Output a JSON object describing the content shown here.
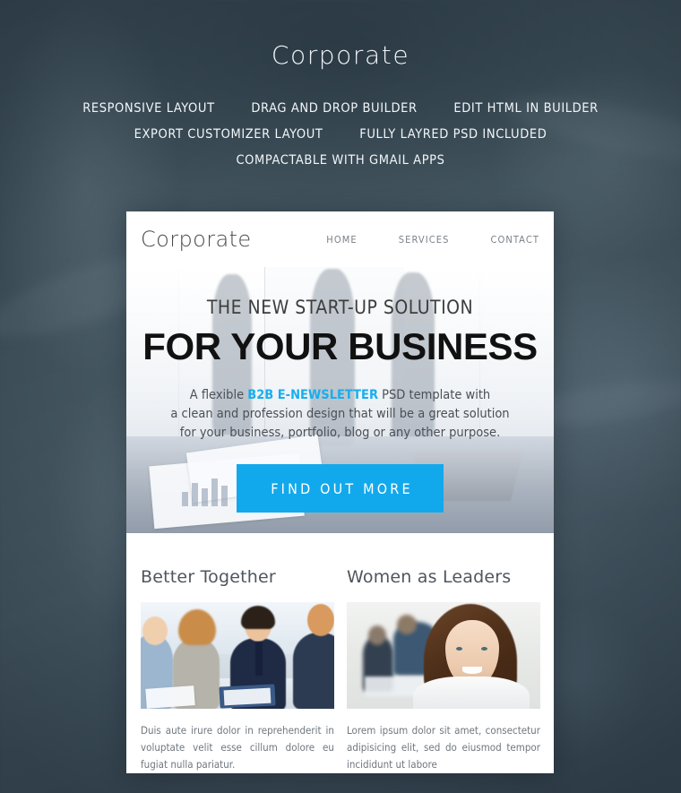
{
  "banner": {
    "title": "Corporate",
    "feature_rows": [
      [
        "RESPONSIVE LAYOUT",
        "DRAG AND DROP BUILDER",
        "EDIT HTML IN BUILDER"
      ],
      [
        "EXPORT CUSTOMIZER LAYOUT",
        "FULLY LAYRED PSD INCLUDED"
      ],
      [
        "COMPACTABLE WITH GMAIL APPS"
      ]
    ]
  },
  "template": {
    "nav": {
      "brand": "Corporate",
      "links": [
        "HOME",
        "SERVICES",
        "CONTACT"
      ]
    },
    "hero": {
      "kicker": "THE NEW START-UP SOLUTION",
      "title": "FOR YOUR BUSINESS",
      "para_part1": "A flexible ",
      "para_highlight": "B2B E-NEWSLETTER",
      "para_part2": " PSD template with",
      "para_line2": "a clean and profession design that will be a great solution",
      "para_line3": "for your business, portfolio, blog or any other purpose.",
      "cta_label": "FIND OUT MORE"
    },
    "columns": [
      {
        "title": "Better Together",
        "image_alt": "business-meeting-photo",
        "text": "Duis aute irure dolor in reprehenderit in voluptate velit esse cillum dolore eu fugiat nulla pariatur."
      },
      {
        "title": "Women as Leaders",
        "image_alt": "businesswoman-portrait-photo",
        "text": "Lorem ipsum dolor sit amet, consectetur adipisicing elit, sed do eiusmod tempor incididunt ut labore"
      }
    ]
  },
  "colors": {
    "accent": "#12a9ec",
    "highlight": "#17aeee",
    "backdrop": "#3f505d",
    "card": "#ffffff",
    "nav_link": "#7a8187",
    "body_text": "#6f777e"
  }
}
